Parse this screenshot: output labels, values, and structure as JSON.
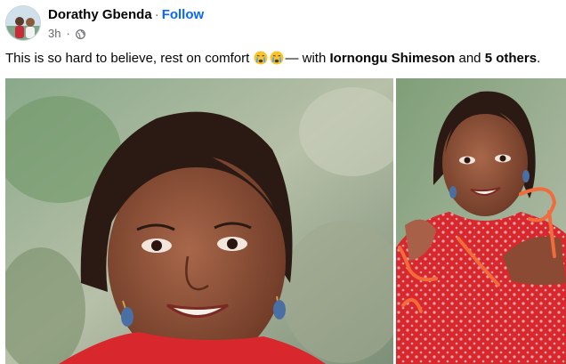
{
  "post": {
    "author": "Dorathy Gbenda",
    "separator": "·",
    "follow_label": "Follow",
    "timestamp": "3h",
    "privacy_icon": "globe-icon",
    "caption": {
      "text": "This is so hard to believe, rest on comfort",
      "emoji": [
        "crying-face",
        "crying-face"
      ],
      "with_text": "— with",
      "tagged_name": "Iornongu Shimeson",
      "and_text": "and",
      "others_text": "5 others",
      "end": "."
    }
  },
  "colors": {
    "link": "#0866ff",
    "secondary_text": "#65676b",
    "annotation": "#f26b3a"
  }
}
